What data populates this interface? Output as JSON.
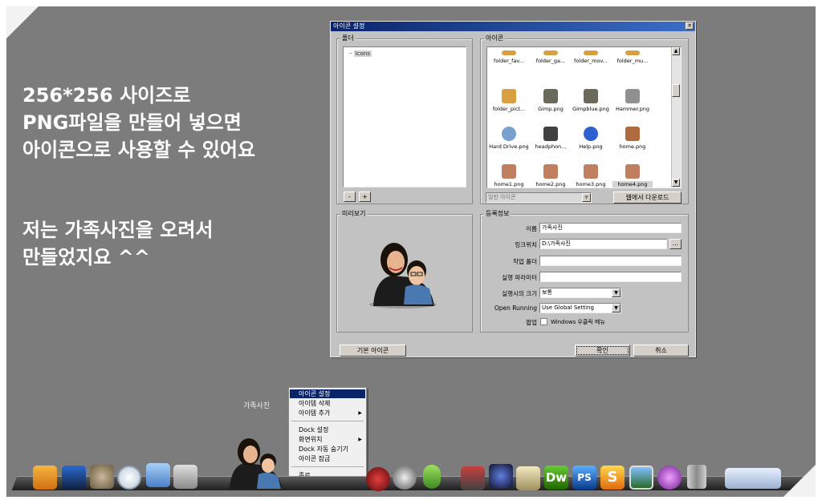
{
  "caption": {
    "line1": "256*256 사이즈로",
    "line2": "PNG파일을 만들어 넣으면",
    "line3": "아이콘으로 사용할 수 있어요",
    "line4": "저는 가족사진을 오려서",
    "line5": "만들었지요 ^^"
  },
  "dialog": {
    "title": "아이콘 설정",
    "folder_group": "폴더",
    "tree_item": "Icons",
    "minus": "-",
    "plus": "+",
    "icons_group": "아이콘",
    "icons": [
      {
        "label": "folder_fav...",
        "icon": "folder-icon"
      },
      {
        "label": "folder_ga...",
        "icon": "folder-icon"
      },
      {
        "label": "folder_mov...",
        "icon": "folder-icon"
      },
      {
        "label": "folder_mu...",
        "icon": "folder-icon"
      },
      {
        "label": "folder_pict...",
        "icon": "folder-icon"
      },
      {
        "label": "Gimp.png",
        "icon": "gimp-icon"
      },
      {
        "label": "Gimpblue.png",
        "icon": "gimp-icon"
      },
      {
        "label": "Hammer.png",
        "icon": "hammer-icon"
      },
      {
        "label": "Hard Drive.png",
        "icon": "drive-icon"
      },
      {
        "label": "headphon...",
        "icon": "headphones-icon"
      },
      {
        "label": "Help.png",
        "icon": "help-icon"
      },
      {
        "label": "home.png",
        "icon": "home-icon"
      },
      {
        "label": "home1.png",
        "icon": "photo-icon"
      },
      {
        "label": "home2.png",
        "icon": "photo-icon"
      },
      {
        "label": "home3.png",
        "icon": "photo-icon"
      },
      {
        "label": "home4.png",
        "icon": "photo-icon"
      }
    ],
    "filter_select": "일반 아이콘",
    "download_button": "웹에서 다운로드",
    "preview_group": "미리보기",
    "info_group": "등록정보",
    "name_label": "이름",
    "name_value": "가족사진",
    "link_label": "링크위치",
    "link_value": "D:\\가족사진",
    "browse_button": "...",
    "workdir_label": "작업 폴더",
    "workdir_value": "",
    "params_label": "실행 파라미터",
    "params_value": "",
    "size_label": "실행시의 크기",
    "size_value": "보통",
    "running_label": "Open Running",
    "running_value": "Use Global Setting",
    "popup_label": "팝업",
    "popup_option": "Windows 우클릭 메뉴",
    "default_icon_button": "기본 아이콘",
    "ok_button": "확인",
    "cancel_button": "취소"
  },
  "context_menu": {
    "hover_label": "가족사진",
    "items": [
      {
        "label": "아이콘 설정"
      },
      {
        "label": "아이템 삭제"
      },
      {
        "label": "아이템 추가"
      },
      {
        "label": "Dock 설정"
      },
      {
        "label": "화면위치"
      },
      {
        "label": "Dock 자동 숨기기"
      },
      {
        "label": "아이콘 잠금"
      },
      {
        "label": "종료"
      }
    ]
  },
  "dock": {
    "dw_label": "Dw",
    "ps_label": "PS",
    "s_label": "S",
    "icons": [
      "folder-icon",
      "computer-icon",
      "cat-icon",
      "clock-icon",
      "network-icon",
      "download-icon",
      "family-photo-icon",
      "music-icon",
      "film-icon",
      "frog-icon",
      "tools-icon",
      "game-icon",
      "people-icon",
      "dreamweaver-icon",
      "photoshop-icon",
      "s-app-icon",
      "monitor-icon",
      "browser-icon",
      "trash-icon",
      "desktop-icon"
    ]
  },
  "colors": {
    "background": "#7c7c7c",
    "dialog": "#c2c2c2",
    "titlebar": "#0a246a",
    "menu_highlight": "#0a246a"
  }
}
